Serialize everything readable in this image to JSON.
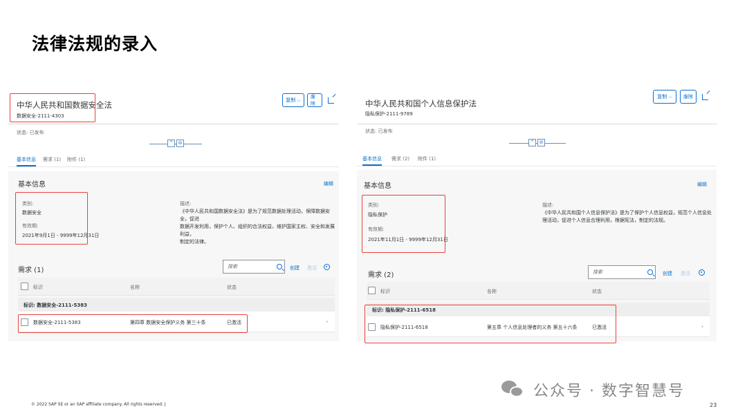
{
  "slide": {
    "title": "法律法规的录入",
    "footer": "© 2022 SAP SE or an SAP affiliate company. All rights reserved.  ǀ",
    "page_number": "23",
    "watermark": "公众号 · 数字智慧号"
  },
  "left": {
    "title": "中华人民共和国数据安全法",
    "subtitle": "数据安全-2111-4303",
    "status": "状态: 已发布",
    "btn_copy": "复制 ⌵",
    "btn_delete": "废除",
    "tabs": [
      "基本信息",
      "需求 (1)",
      "附件 (1)"
    ],
    "section_title": "基本信息",
    "edit": "编辑",
    "category_label": "类别:",
    "category_value": "数据安全",
    "validity_label": "有效期:",
    "validity_value": "2021年9月1日 - 9999年12月31日",
    "desc_label": "描述:",
    "desc_lines": [
      "《中华人民共和国数据安全法》是为了规范数据处理活动，保障数据安全，促进",
      "数据开发利用，保护个人、组织的合法权益，维护国家主权、安全和发展利益，",
      "制定的法律。"
    ],
    "req_title": "需求 (1)",
    "search_placeholder": "搜索",
    "create": "创建",
    "activate": "激活",
    "columns": [
      "标识",
      "名称",
      "状态"
    ],
    "group": "标识: 数据安全-2111-5383",
    "row": {
      "id": "数据安全-2111-5383",
      "name": "第四章 数据安全保护义务 第三十条",
      "status": "已激活"
    }
  },
  "right": {
    "title": "中华人民共和国个人信息保护法",
    "subtitle": "隐私保护-2111-9789",
    "status": "状态: 已发布",
    "btn_copy": "复制 ⌵",
    "btn_delete": "废除",
    "tabs": [
      "基本信息",
      "需求 (2)",
      "附件 (1)"
    ],
    "section_title": "基本信息",
    "edit": "编辑",
    "category_label": "类别:",
    "category_value": "隐私保护",
    "validity_label": "有效期:",
    "validity_value": "2021年11月1日 - 9999年12月31日",
    "desc_label": "描述:",
    "desc_lines": [
      "《中华人民共和国个人信息保护法》是为了保护个人信息权益，规范个人信息处",
      "理活动，促进个人信息合理利用，根据宪法，制定的法规。"
    ],
    "req_title": "需求 (2)",
    "search_placeholder": "搜索",
    "create": "创建",
    "activate": "激活",
    "columns": [
      "标识",
      "名称",
      "状态"
    ],
    "group": "标识: 隐私保护-2111-6518",
    "row": {
      "id": "隐私保护-2111-6518",
      "name": "第五章 个人信息处理者的义务 第五十六条",
      "status": "已激活"
    }
  }
}
